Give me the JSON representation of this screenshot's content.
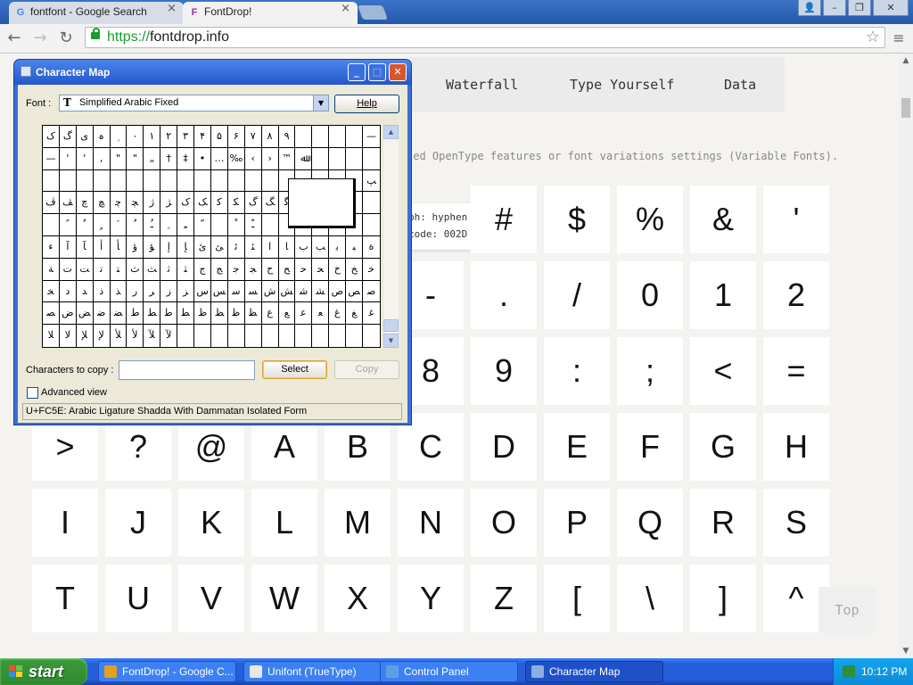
{
  "browser": {
    "tabs": [
      {
        "title": "fontfont - Google Search",
        "favicon": "G",
        "active": false
      },
      {
        "title": "FontDrop!",
        "favicon": "F",
        "active": true
      }
    ],
    "close_glyph": "×",
    "url_scheme": "https://",
    "url_host": "fontdrop.info",
    "window_controls": [
      "user-icon",
      "minimize-icon",
      "restore-icon",
      "close-icon"
    ],
    "nav_icons": [
      "back-icon",
      "forward-icon",
      "reload-icon"
    ],
    "glyphs": {
      "back": "←",
      "forward": "→",
      "reload": "↻",
      "star": "☆",
      "menu": "≡",
      "user": "👤",
      "minimize": "–",
      "restore": "❐",
      "close": "✕"
    }
  },
  "page": {
    "nav": [
      "Waterfall",
      "Type Yourself",
      "Data"
    ],
    "description": "ted OpenType features or font variations settings (Variable Fonts).",
    "tooltip": {
      "line1": "ph: hyphen",
      "line2": "code: 002D"
    },
    "glyph_rows": [
      [
        "#",
        "$",
        "%",
        "&",
        "'"
      ],
      [
        "-",
        ".",
        "/",
        "0",
        "1",
        "2"
      ],
      [
        "8",
        "9",
        ":",
        ";",
        "<",
        "="
      ],
      [
        ">",
        "?",
        "@",
        "A",
        "B",
        "C",
        "D",
        "E",
        "F",
        "G",
        "H"
      ],
      [
        "I",
        "J",
        "K",
        "L",
        "M",
        "N",
        "O",
        "P",
        "Q",
        "R",
        "S"
      ],
      [
        "T",
        "U",
        "V",
        "W",
        "X",
        "Y",
        "Z",
        "[",
        "\\",
        "]",
        "^"
      ]
    ],
    "top_link": "Top"
  },
  "charmap": {
    "title": "Character Map",
    "font_label": "Font :",
    "font_value": "Simplified Arabic Fixed",
    "help_button": "Help",
    "grid": [
      [
        "ک",
        "گ",
        "ی",
        "ہ",
        "ۭ",
        "۰",
        "۱",
        "۲",
        "۳",
        "۴",
        "۵",
        "۶",
        "۷",
        "۸",
        "۹",
        "",
        "",
        "",
        "",
        "—"
      ],
      [
        "—",
        "'",
        "'",
        ",",
        "\"",
        "\"",
        "„",
        "†",
        "‡",
        "•",
        "…",
        "‰",
        "‹",
        "›",
        "™",
        "ﷲ",
        "",
        "",
        "",
        ""
      ],
      [
        "",
        "",
        "",
        "",
        "",
        "",
        "",
        "",
        "",
        "",
        "",
        "",
        "",
        "",
        "",
        "",
        "",
        "",
        "",
        "ﭗ"
      ],
      [
        "ﭪ",
        "ﭫ",
        "ﭺ",
        "ﭻ",
        "ﭼ",
        "ﭽ",
        "ﮊ",
        "ﮋ",
        "ﮎ",
        "ﮏ",
        "ﮐ",
        "ﮑ",
        "ﮒ",
        "ﮓ",
        "ﮔ",
        "ﮕ",
        "",
        "",
        "",
        ""
      ],
      [
        "",
        "ﹰ",
        "ﹲ",
        "ﹴ",
        "ﹶ",
        "ﹸ",
        "ﹹ",
        "ﹺ",
        "ﹻ",
        "ﹼ",
        "",
        "ﹾ",
        "ﹿ",
        "",
        "",
        "",
        "",
        "",
        "",
        ""
      ],
      [
        "ﺀ",
        "ﺁ",
        "ﺂ",
        "ﺃ",
        "ﺄ",
        "ﺅ",
        "ﺆ",
        "ﺇ",
        "ﺈ",
        "ﺉ",
        "ﺊ",
        "ﺋ",
        "ﺌ",
        "ﺍ",
        "ﺎ",
        "ﺏ",
        "ﺐ",
        "ﺑ",
        "ﺒ",
        "ﺓ"
      ],
      [
        "ﺔ",
        "ﺕ",
        "ﺖ",
        "ﺗ",
        "ﺘ",
        "ﺙ",
        "ﺚ",
        "ﺛ",
        "ﺜ",
        "ﺝ",
        "ﺞ",
        "ﺟ",
        "ﺠ",
        "ﺡ",
        "ﺢ",
        "ﺣ",
        "ﺤ",
        "ﺥ",
        "ﺦ",
        "ﺧ"
      ],
      [
        "ﺨ",
        "ﺩ",
        "ﺪ",
        "ﺫ",
        "ﺬ",
        "ﺭ",
        "ﺮ",
        "ﺯ",
        "ﺰ",
        "ﺱ",
        "ﺲ",
        "ﺳ",
        "ﺴ",
        "ﺵ",
        "ﺶ",
        "ﺷ",
        "ﺸ",
        "ﺹ",
        "ﺺ",
        "ﺻ"
      ],
      [
        "ﺼ",
        "ﺽ",
        "ﺾ",
        "ﺿ",
        "ﻀ",
        "ﻁ",
        "ﻂ",
        "ﻃ",
        "ﻄ",
        "ﻅ",
        "ﻆ",
        "ﻇ",
        "ﻈ",
        "ﻉ",
        "ﻊ",
        "ﻋ",
        "ﻌ",
        "ﻍ",
        "ﻎ",
        "ﻏ"
      ],
      [
        "ﻼ",
        "ﻻ",
        "ﻺ",
        "ﻹ",
        "ﻸ",
        "ﻷ",
        "ﻶ",
        "ﻵ",
        "",
        "",
        "",
        "",
        "",
        "",
        "",
        "",
        "",
        "",
        "",
        ""
      ]
    ],
    "chars_label": "Characters to copy :",
    "chars_value": "",
    "select_button": "Select",
    "copy_button": "Copy",
    "advanced_label": "Advanced view",
    "status": "U+FC5E: Arabic Ligature Shadda With Dammatan Isolated Form"
  },
  "taskbar": {
    "start_label": "start",
    "tasks": [
      {
        "label": "FontDrop! - Google C...",
        "icon": "chrome-icon",
        "color": "#e0a020",
        "active": false
      },
      {
        "label": "Unifont (TrueType)",
        "icon": "font-file-icon",
        "color": "#e8e8e8",
        "active": false
      },
      {
        "label": "Control Panel",
        "icon": "control-panel-icon",
        "color": "#5aa0e8",
        "active": false
      },
      {
        "label": "Character Map",
        "icon": "character-map-icon",
        "color": "#8ab0e0",
        "active": true
      }
    ],
    "time": "10:12 PM"
  }
}
